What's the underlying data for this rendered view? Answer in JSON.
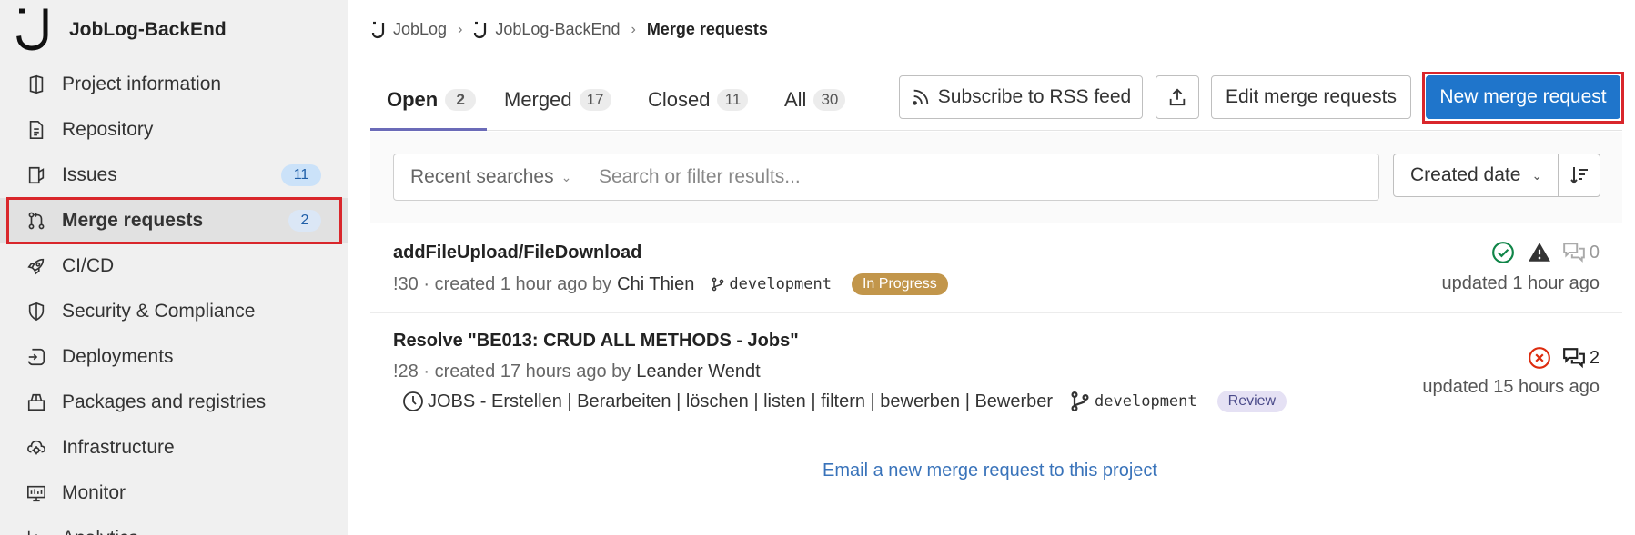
{
  "sidebar": {
    "project_name": "JobLog-BackEnd",
    "items": [
      {
        "label": "Project information",
        "icon": "info-book-icon"
      },
      {
        "label": "Repository",
        "icon": "document-icon"
      },
      {
        "label": "Issues",
        "icon": "issues-icon",
        "badge": "11"
      },
      {
        "label": "Merge requests",
        "icon": "merge-request-icon",
        "badge": "2"
      },
      {
        "label": "CI/CD",
        "icon": "rocket-icon"
      },
      {
        "label": "Security & Compliance",
        "icon": "shield-icon"
      },
      {
        "label": "Deployments",
        "icon": "deployments-icon"
      },
      {
        "label": "Packages and registries",
        "icon": "package-icon"
      },
      {
        "label": "Infrastructure",
        "icon": "cloud-gear-icon"
      },
      {
        "label": "Monitor",
        "icon": "monitor-icon"
      },
      {
        "label": "Analytics",
        "icon": "chart-icon"
      }
    ]
  },
  "breadcrumb": [
    "JobLog",
    "JobLog-BackEnd",
    "Merge requests"
  ],
  "tabs": [
    {
      "label": "Open",
      "count": "2"
    },
    {
      "label": "Merged",
      "count": "17"
    },
    {
      "label": "Closed",
      "count": "11"
    },
    {
      "label": "All",
      "count": "30"
    }
  ],
  "buttons": {
    "rss": "Subscribe to RSS feed",
    "edit": "Edit merge requests",
    "new": "New merge request"
  },
  "filter": {
    "recent": "Recent searches",
    "search_placeholder": "Search or filter results...",
    "sort": "Created date"
  },
  "merge_requests": [
    {
      "title": "addFileUpload/FileDownload",
      "ref": "!30 · created 1 hour ago by",
      "author": "Chi Thien",
      "branch": "development",
      "label": "In Progress",
      "comments": "0",
      "updated": "updated 1 hour ago"
    },
    {
      "title": "Resolve \"BE013: CRUD ALL METHODS - Jobs\"",
      "ref": "!28 · created 17 hours ago by",
      "author": "Leander Wendt",
      "milestone": "JOBS - Erstellen | Berarbeiten | löschen | listen | filtern | bewerben | Bewerber",
      "branch": "development",
      "label": "Review",
      "comments": "2",
      "updated": "updated 15 hours ago"
    }
  ],
  "email_link": "Email a new merge request to this project",
  "colors": {
    "primary": "#1f75cb",
    "highlight": "#d9262b",
    "success": "#108548",
    "failed": "#dd2b0e",
    "label_progress": "#c2964b"
  }
}
